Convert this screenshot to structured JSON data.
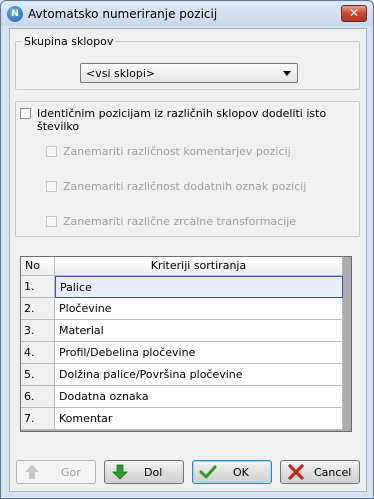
{
  "window": {
    "title": "Avtomatsko numeriranje pozicij",
    "app_icon_glyph": "N",
    "close_glyph": "✕"
  },
  "group": {
    "legend": "Skupina sklopov",
    "selected": "<vsi sklopi>"
  },
  "options": {
    "main_checkbox": {
      "label": "Identičnim pozicijam iz različnih sklopov dodeliti isto številko",
      "checked": false
    },
    "sub_checkboxes": [
      {
        "label": "Zanemariti različnost komentarjev pozicij",
        "checked": false,
        "enabled": false
      },
      {
        "label": "Zanemariti različnost dodatnih oznak pozicij",
        "checked": false,
        "enabled": false
      },
      {
        "label": "Zanemariti različne zrcalne transformacije",
        "checked": false,
        "enabled": false
      }
    ]
  },
  "table": {
    "headers": [
      "No",
      "Kriteriji sortiranja"
    ],
    "rows": [
      {
        "n": "1.",
        "criterion": "Palice",
        "selected": true
      },
      {
        "n": "2.",
        "criterion": "Pločevine"
      },
      {
        "n": "3.",
        "criterion": "Material"
      },
      {
        "n": "4.",
        "criterion": "Profil/Debelina pločevine"
      },
      {
        "n": "5.",
        "criterion": "Dolžina palice/Površina pločevine"
      },
      {
        "n": "6.",
        "criterion": "Dodatna oznaka"
      },
      {
        "n": "7.",
        "criterion": "Komentar"
      }
    ]
  },
  "buttons": {
    "up": "Gor",
    "down": "Dol",
    "ok": "OK",
    "cancel": "Cancel"
  },
  "colors": {
    "selection_border": "#3c4fb5",
    "down_arrow": "#2f9a2a",
    "ok_check": "#2f9a2a",
    "cancel_x": "#c8261f"
  }
}
